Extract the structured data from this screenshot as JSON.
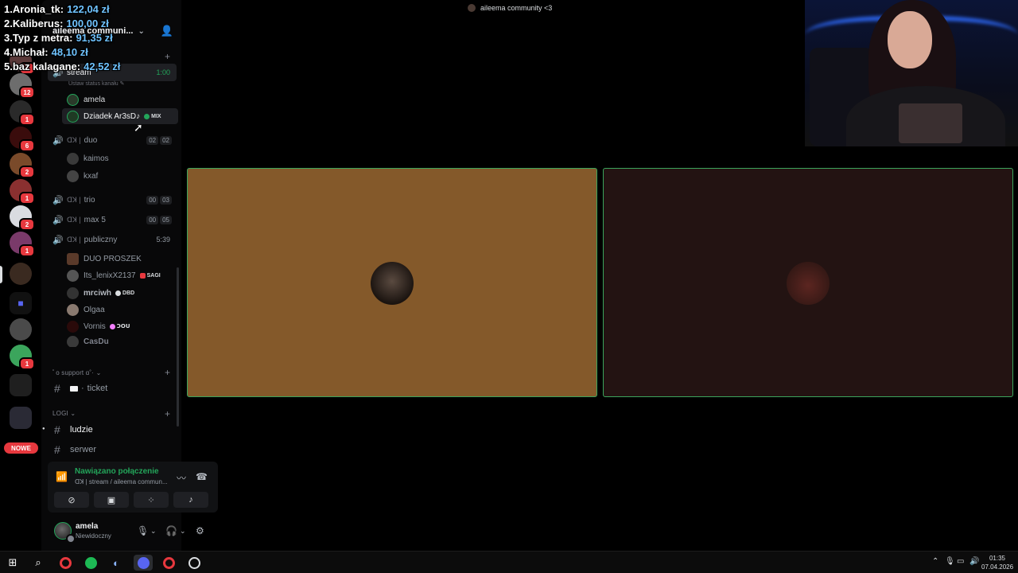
{
  "leaderboard": [
    {
      "label": "1.Aronia_tk:",
      "amount": "122,04 zł"
    },
    {
      "label": "2.Kaliberus:",
      "amount": "100,00 zł"
    },
    {
      "label": "3.Typ z metra:",
      "amount": "91,35 zł"
    },
    {
      "label": "4.Michał:",
      "amount": "48,10 zł"
    },
    {
      "label": "5.baz kalagane:",
      "amount": "42,52 zł"
    }
  ],
  "server": {
    "name": "aileema communi..."
  },
  "rail": {
    "badges": [
      "2",
      "12",
      "1",
      "6",
      "2",
      "1",
      "2",
      "1",
      "1"
    ],
    "new_label": "NOWE"
  },
  "channels": {
    "stream": {
      "name": "stream",
      "timer": "1:00",
      "status_hint": "Ustaw status kanału"
    },
    "stream_members": [
      {
        "name": "amela"
      },
      {
        "name": "Dziadek Ar3sD♪",
        "tag": "MIX"
      }
    ],
    "duo": {
      "name": "duo",
      "count_a": "02",
      "count_b": "02"
    },
    "duo_members": [
      {
        "name": "kaimos"
      },
      {
        "name": "kxaf"
      }
    ],
    "trio": {
      "name": "trio",
      "count_a": "00",
      "count_b": "03"
    },
    "max5": {
      "name": "max 5",
      "count_a": "00",
      "count_b": "05"
    },
    "publiczny": {
      "name": "publiczny",
      "timer": "5:39"
    },
    "publiczny_members": [
      {
        "name": "DUO PROSZEK"
      },
      {
        "name": "Its_lenixX2137",
        "tag": "SAGI"
      },
      {
        "name": "mrciwh",
        "tag": "DBD"
      },
      {
        "name": "Olgaa"
      },
      {
        "name": "Vornis",
        "tag": "ꓛꓳꓴ"
      },
      {
        "name": "CasDu"
      }
    ],
    "support_category": "ﾟo support ɑ˚·",
    "ticket": "ticket",
    "logi_category": "LOGI",
    "ludzie": "ludzie",
    "serwer": "serwer"
  },
  "voice_panel": {
    "title": "Nawiązano połączenie",
    "subtitle": "stream / aileema commun..."
  },
  "user_panel": {
    "name": "amela",
    "status": "Niewidoczny"
  },
  "main": {
    "title": "aileema community <3"
  },
  "taskbar": {
    "time": "01:35",
    "date": "07.04.2026"
  },
  "colors": {
    "connected_green": "#23a55a",
    "tile_left": "#84592a",
    "tile_right": "#231312",
    "badge_red": "#e7383e",
    "amount_blue": "#6fc3ff"
  }
}
